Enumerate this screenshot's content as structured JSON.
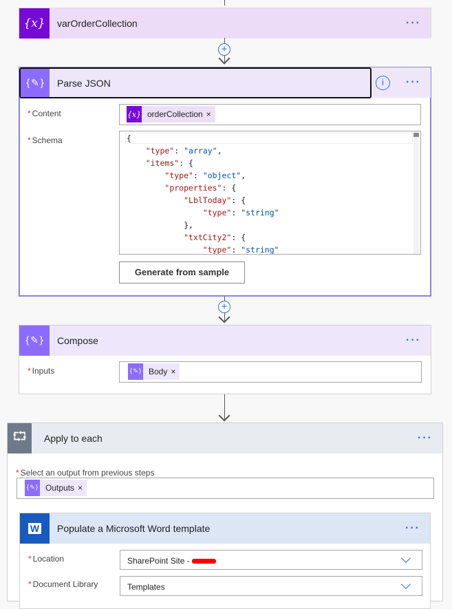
{
  "var_card": {
    "title": "varOrderCollection",
    "icon": "variable-icon",
    "more": "···"
  },
  "parse_card": {
    "title": "Parse JSON",
    "icon": "data-operation-icon",
    "more": "···",
    "content_label": "Content",
    "content_token": "orderCollection",
    "schema_label": "Schema",
    "schema_lines": [
      [
        "{",
        "",
        ""
      ],
      [
        "    ",
        "\"type\"",
        ": ",
        "\"array\"",
        ","
      ],
      [
        "    ",
        "\"items\"",
        ": {"
      ],
      [
        "        ",
        "\"type\"",
        ": ",
        "\"object\"",
        ","
      ],
      [
        "        ",
        "\"properties\"",
        ": {"
      ],
      [
        "            ",
        "\"LblToday\"",
        ": {"
      ],
      [
        "                ",
        "\"type\"",
        ": ",
        "\"string\""
      ],
      [
        "            ",
        "},"
      ],
      [
        "            ",
        "\"txtCity2\"",
        ": {"
      ],
      [
        "                ",
        "\"type\"",
        ": ",
        "\"string\""
      ]
    ],
    "generate_button": "Generate from sample"
  },
  "compose_card": {
    "title": "Compose",
    "more": "···",
    "inputs_label": "Inputs",
    "inputs_token": "Body"
  },
  "apply_card": {
    "title": "Apply to each",
    "more": "···",
    "select_label": "Select an output from previous steps",
    "select_token": "Outputs"
  },
  "word_card": {
    "title": "Populate a Microsoft Word template",
    "more": "···",
    "location_label": "Location",
    "location_value": "SharePoint Site - ",
    "library_label": "Document Library",
    "library_value": "Templates"
  },
  "required_mark": "*",
  "remove": "×",
  "plus": "+",
  "colors": {
    "variable": "#770bd6",
    "data_op": "#8c6cff",
    "loop": "#6e7a89",
    "word": "#185abd",
    "link": "#2a6fcf"
  }
}
